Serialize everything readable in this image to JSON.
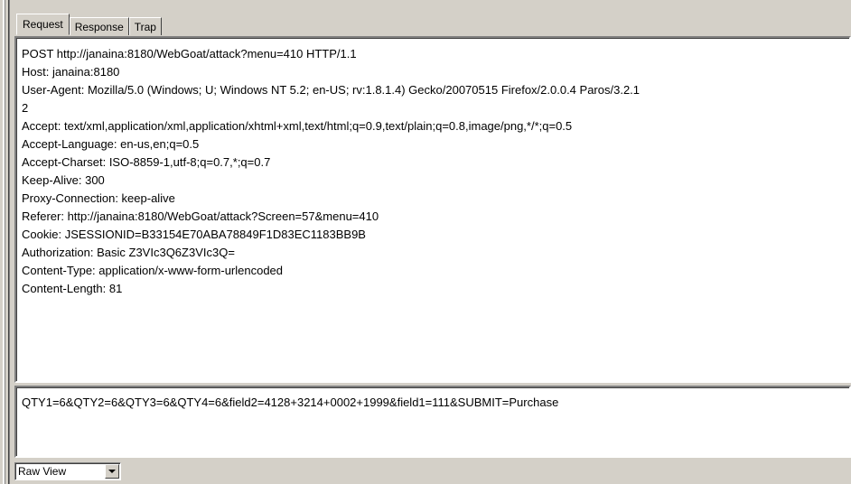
{
  "tabs": [
    {
      "label": "Request",
      "active": true
    },
    {
      "label": "Response",
      "active": false
    },
    {
      "label": "Trap",
      "active": false
    }
  ],
  "request_headers": [
    "POST http://janaina:8180/WebGoat/attack?menu=410 HTTP/1.1",
    "Host: janaina:8180",
    "User-Agent: Mozilla/5.0 (Windows; U; Windows NT 5.2; en-US; rv:1.8.1.4) Gecko/20070515 Firefox/2.0.0.4 Paros/3.2.1",
    "2",
    "Accept: text/xml,application/xml,application/xhtml+xml,text/html;q=0.9,text/plain;q=0.8,image/png,*/*;q=0.5",
    "Accept-Language: en-us,en;q=0.5",
    "Accept-Charset: ISO-8859-1,utf-8;q=0.7,*;q=0.7",
    "Keep-Alive: 300",
    "Proxy-Connection: keep-alive",
    "Referer: http://janaina:8180/WebGoat/attack?Screen=57&menu=410",
    "Cookie: JSESSIONID=B33154E70ABA78849F1D83EC1183BB9B",
    "Authorization: Basic Z3VIc3Q6Z3VIc3Q=",
    "Content-Type: application/x-www-form-urlencoded",
    "Content-Length: 81"
  ],
  "request_body": "QTY1=6&QTY2=6&QTY3=6&QTY4=6&field2=4128+3214+0002+1999&field1=111&SUBMIT=Purchase",
  "view_select": {
    "selected": "Raw View"
  }
}
